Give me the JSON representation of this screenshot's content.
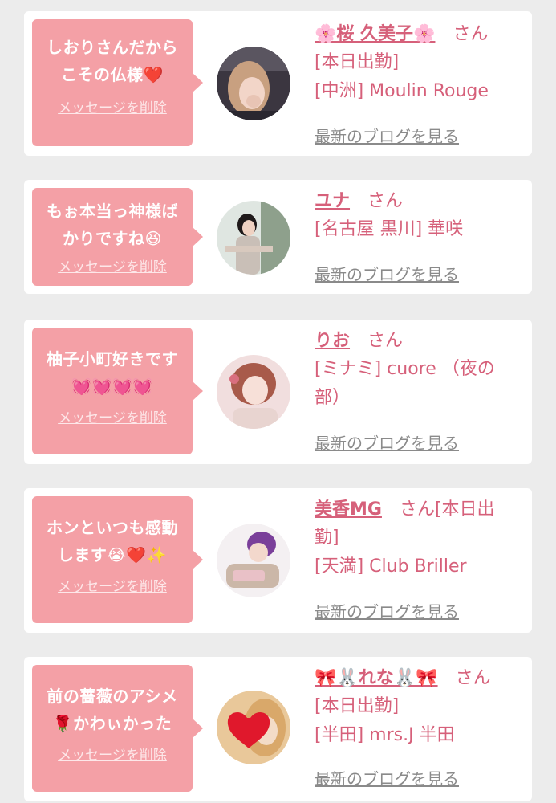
{
  "delete_label": "メッセージを削除",
  "blog_label": "最新のブログを見る",
  "honorific": "さん",
  "colors": {
    "bubble": "#f4a0a6",
    "accent": "#d6607a",
    "background": "#ececec",
    "blog_link": "#8a8a8a"
  },
  "cards": [
    {
      "message_l1": "しおりさんだから",
      "message_l2": "こその仏様❤️",
      "name": "🌸桜 久美子🌸",
      "line1": "[本日出勤]",
      "line2": "[中洲] Moulin Rouge",
      "line3": ""
    },
    {
      "message_l1": "もぉ本当っ神様ば",
      "message_l2": "かりですね😆",
      "name": "ユナ",
      "line1": "[名古屋 黒川] 華咲",
      "line2": "",
      "line3": ""
    },
    {
      "message_l1": "柚子小町好きです",
      "message_l2": "💓💓💓💓",
      "name": "りお",
      "line1": "[ミナミ] cuore （夜の",
      "line2": "部）",
      "line3": ""
    },
    {
      "message_l1": "ホンといつも感動",
      "message_l2": "します😭❤️✨",
      "name": "美香MG",
      "name_suffix": "さん[本日出",
      "line1": "勤]",
      "line2": "[天満] Club Briller",
      "line3": ""
    },
    {
      "message_l1": "前の薔薇のアシメ",
      "message_l2": "🌹かわぃかった",
      "name": "🎀🐰れな🐰🎀",
      "line1": "[本日出勤]",
      "line2": "[半田] mrs.J 半田",
      "line3": ""
    }
  ]
}
